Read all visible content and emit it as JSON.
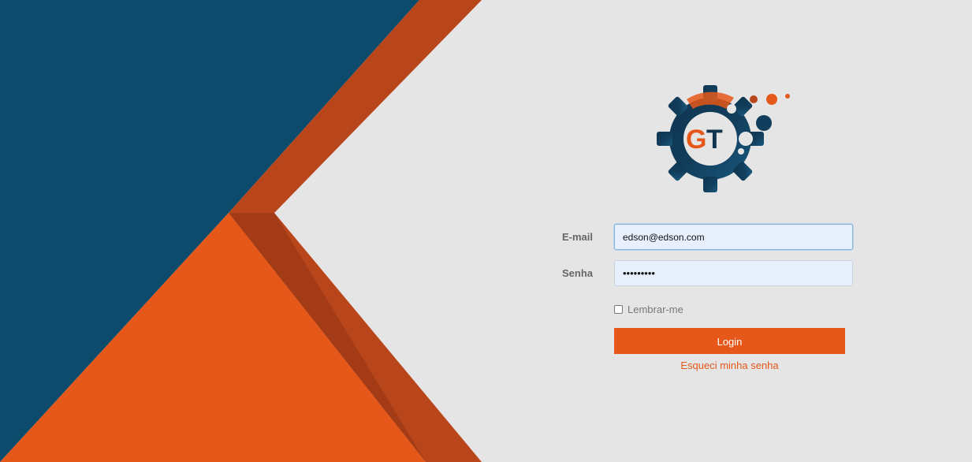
{
  "login": {
    "email_label": "E-mail",
    "email_value": "edson@edson.com",
    "password_label": "Senha",
    "password_value": "•••••••••",
    "remember_label": "Lembrar-me",
    "login_button": "Login",
    "forgot_link": "Esqueci minha senha"
  },
  "logo": {
    "letters": "GT",
    "icon": "gear-logo-icon"
  },
  "colors": {
    "navy": "#0d4b6d",
    "orange": "#e55819",
    "dark_orange": "#b9451b",
    "background": "#e6e5e5"
  }
}
